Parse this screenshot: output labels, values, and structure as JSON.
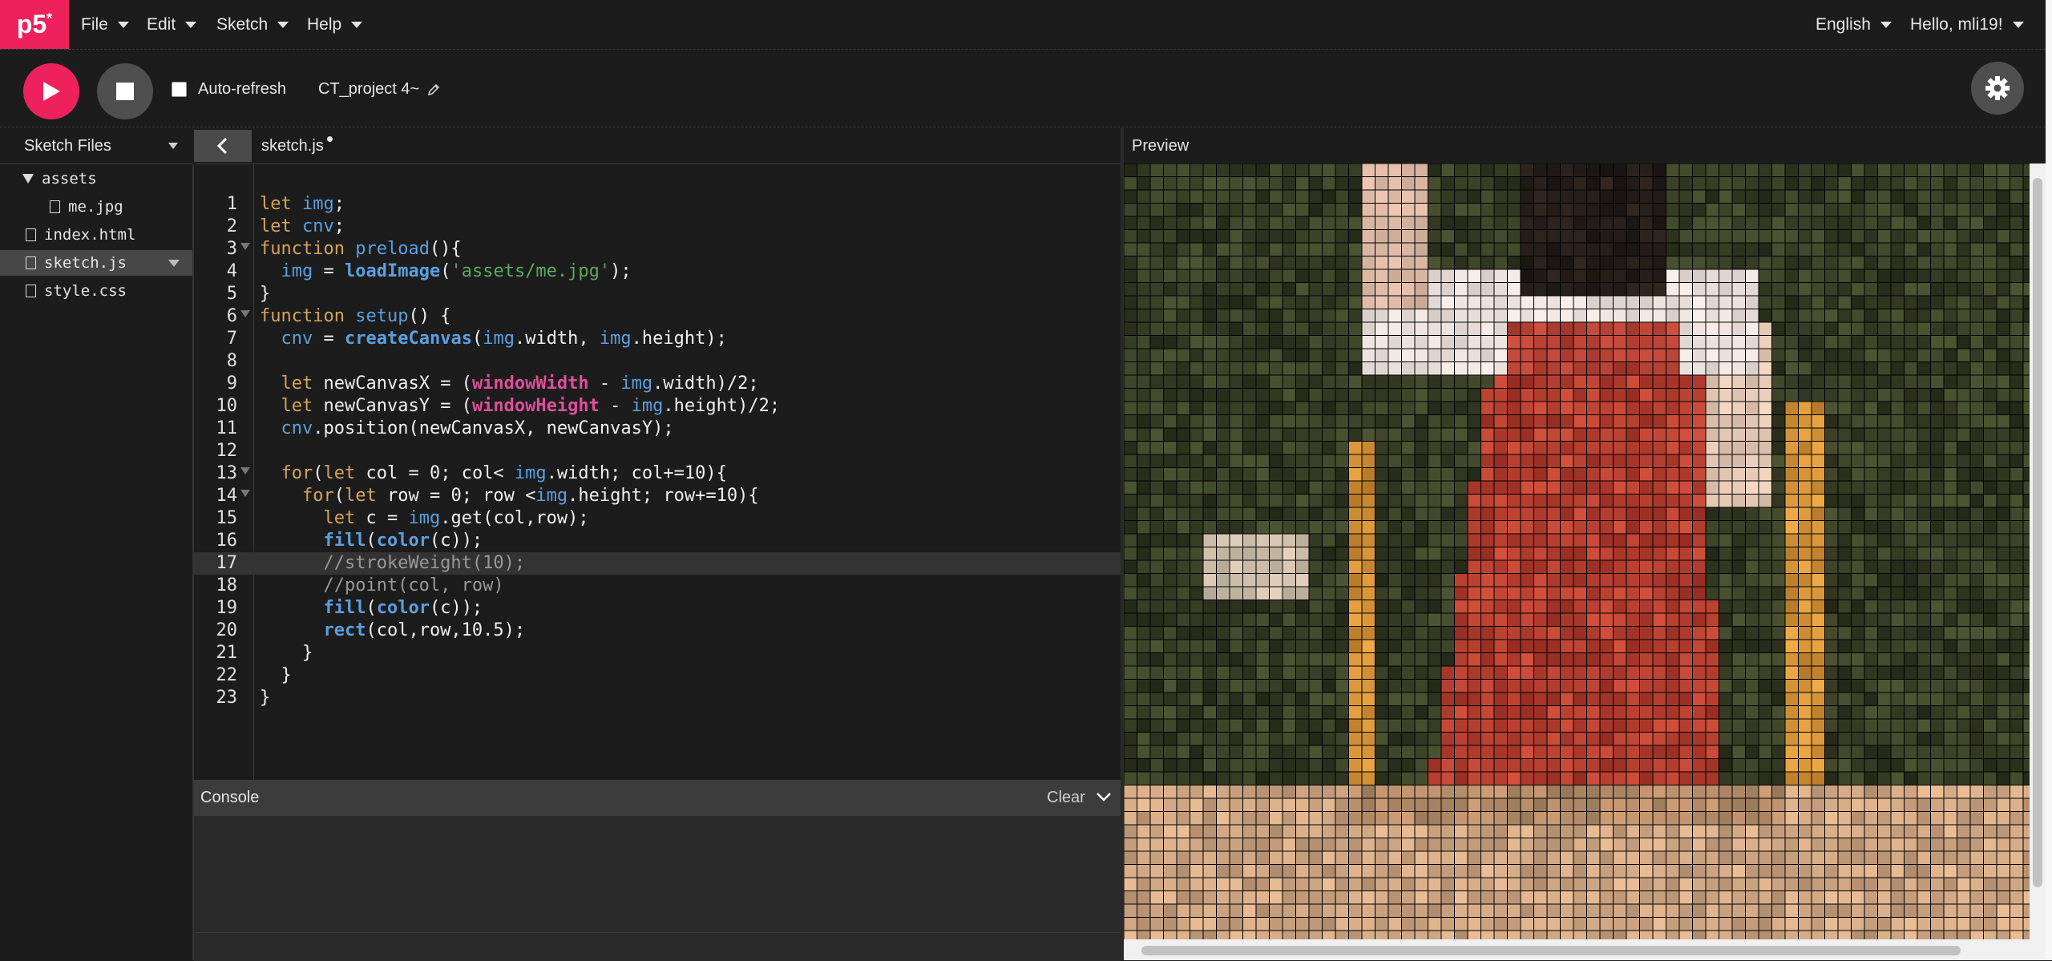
{
  "nav": {
    "logo": "p5",
    "logo_sup": "*",
    "menus": [
      "File",
      "Edit",
      "Sketch",
      "Help"
    ],
    "language": "English",
    "user": "Hello, mli19!"
  },
  "toolbar": {
    "auto_refresh_label": "Auto-refresh",
    "auto_refresh_checked": false,
    "project_name": "CT_project 4~"
  },
  "sidebar": {
    "title": "Sketch Files",
    "files": [
      {
        "name": "assets",
        "type": "folder",
        "expanded": true
      },
      {
        "name": "me.jpg",
        "type": "file",
        "child": true
      },
      {
        "name": "index.html",
        "type": "file"
      },
      {
        "name": "sketch.js",
        "type": "file",
        "active": true
      },
      {
        "name": "style.css",
        "type": "file"
      }
    ]
  },
  "editor": {
    "tab_name": "sketch.js",
    "unsaved": true,
    "active_line": 17,
    "line_numbers": [
      "1",
      "2",
      "3",
      "4",
      "5",
      "6",
      "7",
      "8",
      "9",
      "10",
      "11",
      "12",
      "13",
      "14",
      "15",
      "16",
      "17",
      "18",
      "19",
      "20",
      "21",
      "22",
      "23"
    ],
    "folds": [
      3,
      6,
      13,
      14
    ],
    "code_lines": [
      "let img;",
      "let cnv;",
      "function preload(){",
      "  img = loadImage('assets/me.jpg');",
      "}",
      "function setup() {",
      "  cnv = createCanvas(img.width, img.height);",
      "",
      "  let newCanvasX = (windowWidth - img.width)/2;",
      "  let newCanvasY = (windowHeight - img.height)/2;",
      "  cnv.position(newCanvasX, newCanvasY);",
      "",
      "  for(let col = 0; col< img.width; col+=10){",
      "    for(let row = 0; row <img.height; row+=10){",
      "      let c = img.get(col,row);",
      "      fill(color(c));",
      "      //strokeWeight(10);",
      "      //point(col, row)",
      "      fill(color(c));",
      "      rect(col,row,10.5);",
      "    }",
      "  }",
      "}"
    ]
  },
  "console": {
    "title": "Console",
    "clear_label": "Clear"
  },
  "preview": {
    "title": "Preview"
  },
  "colors": {
    "accent": "#ed225d",
    "background": "#1c1c1c",
    "keyword": "#d4a35c",
    "function": "#5b9fe0",
    "string": "#5ea85d",
    "special": "#de4e9b",
    "comment": "#999999"
  },
  "icons": [
    "play-icon",
    "stop-icon",
    "pencil-icon",
    "gear-icon",
    "chevron-left-icon",
    "chevron-down-icon",
    "file-icon",
    "folder-triangle-icon"
  ]
}
